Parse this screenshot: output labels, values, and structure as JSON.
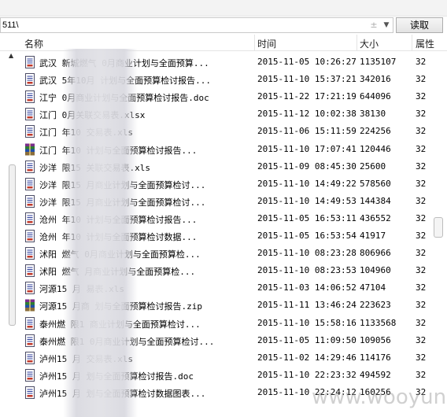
{
  "path": {
    "value": "511\\",
    "plusminus_glyph": "±",
    "dropdown_glyph": "▼"
  },
  "read_button": {
    "label": "读取"
  },
  "columns": {
    "name": "名称",
    "time": "时间",
    "size": "大小",
    "attr": "属性"
  },
  "left_scroll_arrow": "▲",
  "files": [
    {
      "name": "武汉   新城燃气 0月商业计划与全面预算...",
      "time": "2015-11-05 10:26:27",
      "size": "1135107",
      "attr": "32",
      "icon": "doc-icon"
    },
    {
      "name": "武汉   5年10月 计划与全面预算检讨报告...",
      "time": "2015-11-10 15:37:21",
      "size": "342016",
      "attr": "32",
      "icon": "doc-icon"
    },
    {
      "name": "江宁   0月商业计划与全面预算检讨报告.doc",
      "time": "2015-11-22 17:21:19",
      "size": "644096",
      "attr": "32",
      "icon": "doc-icon"
    },
    {
      "name": "江门   0月关联交易表.xlsx",
      "time": "2015-11-12 10:02:38",
      "size": "38130",
      "attr": "32",
      "icon": "doc-icon"
    },
    {
      "name": "江门   年10   交易表.xls",
      "time": "2015-11-06 15:11:59",
      "size": "224256",
      "attr": "32",
      "icon": "doc-icon"
    },
    {
      "name": "江门   年10   计划与全面预算检讨报告...",
      "time": "2015-11-10 17:07:41",
      "size": "120446",
      "attr": "32",
      "icon": "zip-icon"
    },
    {
      "name": "沙洋   限15    关联交易表.xls",
      "time": "2015-11-09 08:45:30",
      "size": "25600",
      "attr": "32",
      "icon": "doc-icon"
    },
    {
      "name": "沙洋   限15    月商业计划与全面预算检讨...",
      "time": "2015-11-10 14:49:22",
      "size": "578560",
      "attr": "32",
      "icon": "doc-icon"
    },
    {
      "name": "沙洋   限15    月商业计划与全面预算检讨...",
      "time": "2015-11-10 14:49:53",
      "size": "144384",
      "attr": "32",
      "icon": "doc-icon"
    },
    {
      "name": "沧州   年10    计划与全面预算检讨报告...",
      "time": "2015-11-05 16:53:11",
      "size": "436552",
      "attr": "32",
      "icon": "doc-icon"
    },
    {
      "name": "沧州   年10    计划与全面预算检讨数据...",
      "time": "2015-11-05 16:53:54",
      "size": "41917",
      "attr": "32",
      "icon": "doc-icon"
    },
    {
      "name": "沭阳   燃气    0月商业计划与全面预算检...",
      "time": "2015-11-10 08:23:28",
      "size": "806966",
      "attr": "32",
      "icon": "doc-icon"
    },
    {
      "name": "沭阳   燃气    月商业计划与全面预算检...",
      "time": "2015-11-10 08:23:53",
      "size": "104960",
      "attr": "32",
      "icon": "doc-icon"
    },
    {
      "name": "河源15  月    易表.xls",
      "time": "2015-11-03 14:06:52",
      "size": "47104",
      "attr": "32",
      "icon": "doc-icon"
    },
    {
      "name": "河源15  月商   划与全面预算检讨报告.zip",
      "time": "2015-11-11 13:46:24",
      "size": "223623",
      "attr": "32",
      "icon": "zip-icon"
    },
    {
      "name": "泰州燃  限1    商业计划与全面预算检讨...",
      "time": "2015-11-10 15:58:16",
      "size": "1133568",
      "attr": "32",
      "icon": "doc-icon"
    },
    {
      "name": "泰州燃  限1    0月商业计划与全面预算检讨...",
      "time": "2015-11-05 11:09:50",
      "size": "109056",
      "attr": "32",
      "icon": "doc-icon"
    },
    {
      "name": "泸州15  月     交易表.xls",
      "time": "2015-11-02 14:29:46",
      "size": "114176",
      "attr": "32",
      "icon": "doc-icon"
    },
    {
      "name": "泸州15  月     划与全面预算检讨报告.doc",
      "time": "2015-11-10 22:23:32",
      "size": "494592",
      "attr": "32",
      "icon": "doc-icon"
    },
    {
      "name": "泸州15  月     划与全面预算检讨数据图表...",
      "time": "2015-11-10 22:24:12",
      "size": "160256",
      "attr": "32",
      "icon": "doc-icon"
    }
  ],
  "watermark": "www.wooyun.org"
}
